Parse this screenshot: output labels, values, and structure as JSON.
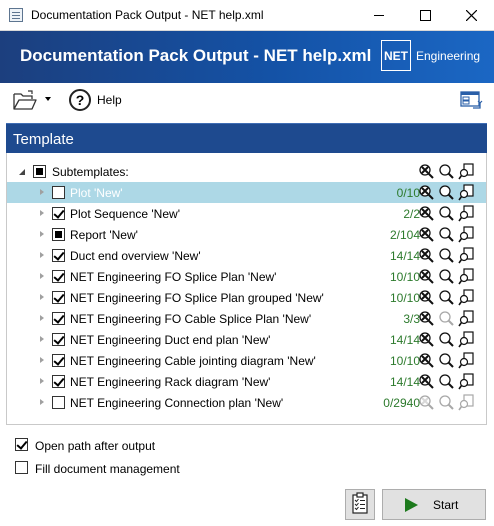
{
  "window": {
    "title": "Documentation Pack Output - NET help.xml",
    "icon": "document-list-icon"
  },
  "banner": {
    "title": "Documentation Pack Output - NET help.xml",
    "logo_box": "NET",
    "logo_text": "Engineering",
    "colors": {
      "start": "#1c3f7e",
      "end": "#1b67c4"
    }
  },
  "toolbar": {
    "open_icon": "folder-open-icon",
    "help_label": "Help",
    "layout_icon": "window-layout-icon"
  },
  "section": {
    "title": "Template",
    "color": "#1e4a8f"
  },
  "tree": {
    "root": {
      "label": "Subtemplates:",
      "state": "partial"
    },
    "items": [
      {
        "label": "Plot 'New'",
        "count": "0/10",
        "checked": false,
        "state": "unchecked",
        "selected": true,
        "icons": [
          "active",
          "active",
          "active"
        ]
      },
      {
        "label": "Plot Sequence 'New'",
        "count": "2/2",
        "checked": true,
        "state": "checked",
        "selected": false,
        "icons": [
          "active",
          "active",
          "active"
        ]
      },
      {
        "label": "Report 'New'",
        "count": "2/104",
        "checked": true,
        "state": "partial",
        "selected": false,
        "icons": [
          "active",
          "active",
          "active"
        ]
      },
      {
        "label": "Duct end overview 'New'",
        "count": "14/14",
        "checked": true,
        "state": "checked",
        "selected": false,
        "icons": [
          "active",
          "active",
          "active"
        ]
      },
      {
        "label": "NET Engineering FO Splice Plan 'New'",
        "count": "10/10",
        "checked": true,
        "state": "checked",
        "selected": false,
        "icons": [
          "active",
          "active",
          "active"
        ]
      },
      {
        "label": "NET Engineering FO Splice Plan grouped 'New'",
        "count": "10/10",
        "checked": true,
        "state": "checked",
        "selected": false,
        "icons": [
          "active",
          "active",
          "active"
        ]
      },
      {
        "label": "NET Engineering FO Cable Splice Plan 'New'",
        "count": "3/3",
        "checked": true,
        "state": "checked",
        "selected": false,
        "icons": [
          "active",
          "faded",
          "active"
        ]
      },
      {
        "label": "NET Engineering Duct end plan 'New'",
        "count": "14/14",
        "checked": true,
        "state": "checked",
        "selected": false,
        "icons": [
          "active",
          "active",
          "active"
        ]
      },
      {
        "label": "NET Engineering Cable jointing diagram 'New'",
        "count": "10/10",
        "checked": true,
        "state": "checked",
        "selected": false,
        "icons": [
          "active",
          "active",
          "active"
        ]
      },
      {
        "label": "NET Engineering Rack diagram 'New'",
        "count": "14/14",
        "checked": true,
        "state": "checked",
        "selected": false,
        "icons": [
          "active",
          "active",
          "active"
        ]
      },
      {
        "label": "NET Engineering Connection plan 'New'",
        "count": "0/2940",
        "checked": false,
        "state": "unchecked",
        "selected": false,
        "icons": [
          "faded",
          "faded",
          "faded"
        ]
      }
    ],
    "count_color": "#2c7a2c",
    "selected_color": "#add8e6"
  },
  "options": {
    "open_path": {
      "label": "Open path after output",
      "checked": true
    },
    "fill_dm": {
      "label": "Fill document management",
      "checked": false
    }
  },
  "buttons": {
    "clipboard_icon": "clipboard-checklist-icon",
    "start_label": "Start",
    "start_icon": "play-arrow-icon"
  }
}
